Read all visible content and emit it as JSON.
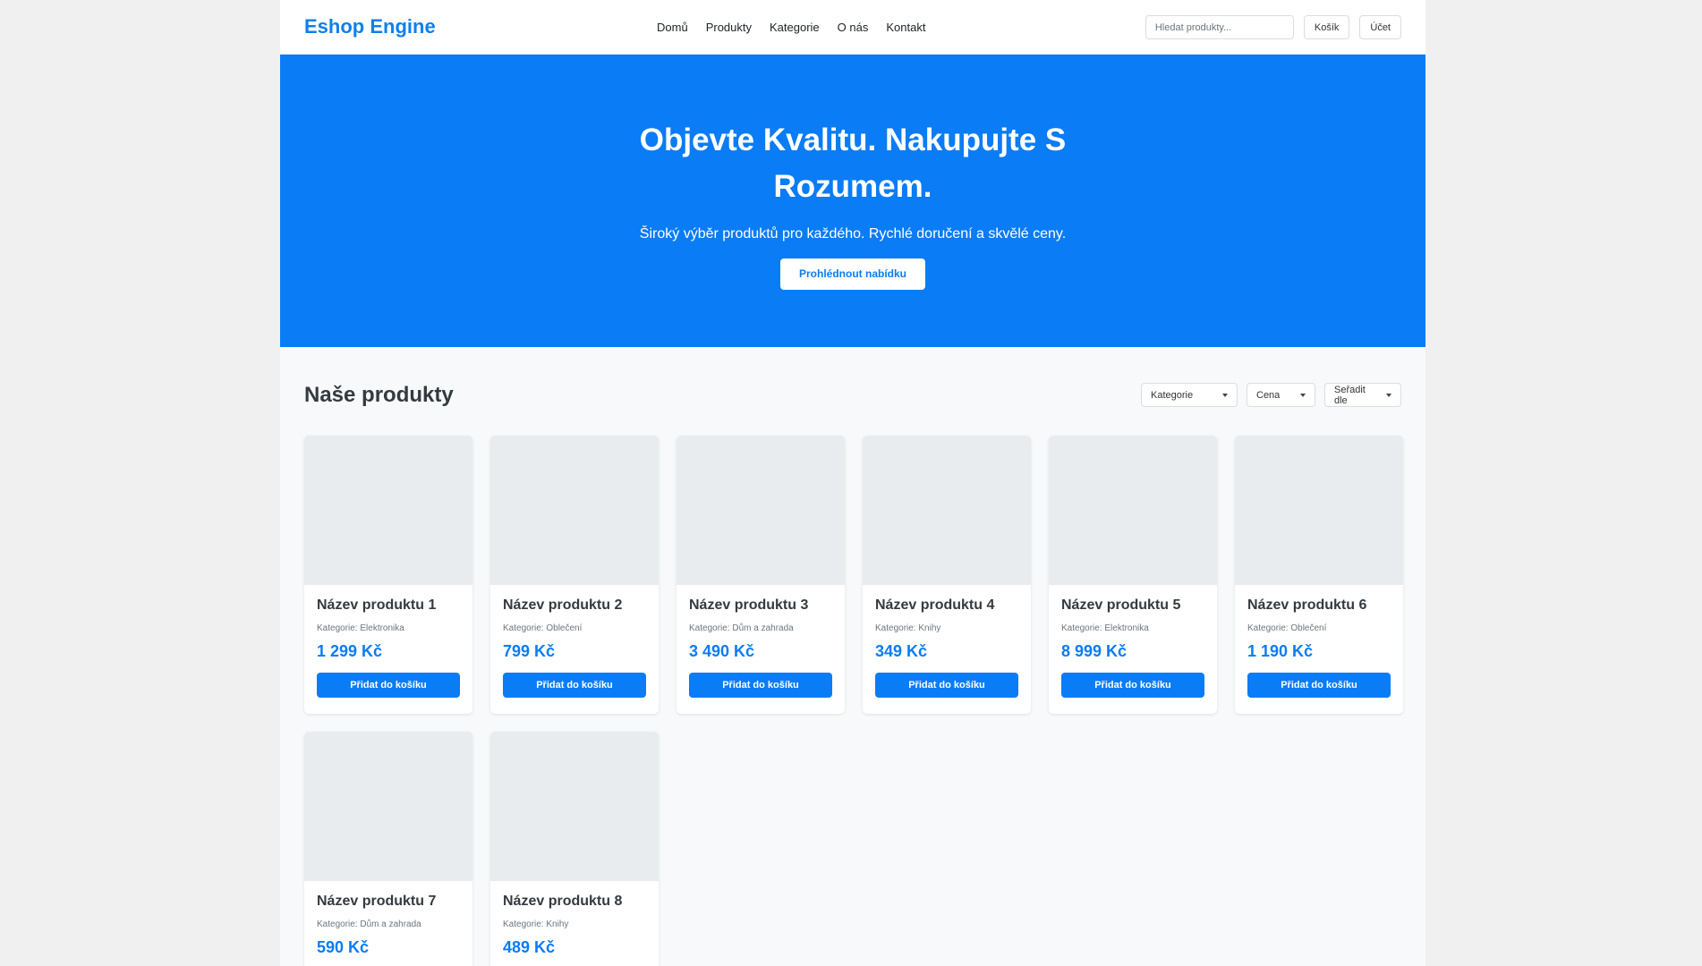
{
  "header": {
    "logo": "Eshop Engine",
    "nav": [
      "Domů",
      "Produkty",
      "Kategorie",
      "O nás",
      "Kontakt"
    ],
    "search_placeholder": "Hledat produkty...",
    "cart_label": "Košík",
    "account_label": "Účet"
  },
  "hero": {
    "title": "Objevte Kvalitu. Nakupujte S Rozumem.",
    "subtitle": "Široký výběr produktů pro každého. Rychlé doručení a skvělé ceny.",
    "cta_label": "Prohlédnout nabídku"
  },
  "products_section": {
    "title": "Naše produkty",
    "filters": [
      "Kategorie",
      "Cena",
      "Seřadit dle"
    ]
  },
  "add_to_cart_label": "Přidat do košíku",
  "products": [
    {
      "name": "Název produktu 1",
      "category": "Kategorie: Elektronika",
      "price": "1 299 Kč"
    },
    {
      "name": "Název produktu 2",
      "category": "Kategorie: Oblečení",
      "price": "799 Kč"
    },
    {
      "name": "Název produktu 3",
      "category": "Kategorie: Dům a zahrada",
      "price": "3 490 Kč"
    },
    {
      "name": "Název produktu 4",
      "category": "Kategorie: Knihy",
      "price": "349 Kč"
    },
    {
      "name": "Název produktu 5",
      "category": "Kategorie: Elektronika",
      "price": "8 999 Kč"
    },
    {
      "name": "Název produktu 6",
      "category": "Kategorie: Oblečení",
      "price": "1 190 Kč"
    },
    {
      "name": "Název produktu 7",
      "category": "Kategorie: Dům a zahrada",
      "price": "590 Kč"
    },
    {
      "name": "Název produktu 8",
      "category": "Kategorie: Knihy",
      "price": "489 Kč"
    }
  ],
  "colors": {
    "accent": "#0a7cf5",
    "logo": "#0d7ff0",
    "placeholder_image": "#e9ecef",
    "page_background": "#f8f9fa"
  }
}
